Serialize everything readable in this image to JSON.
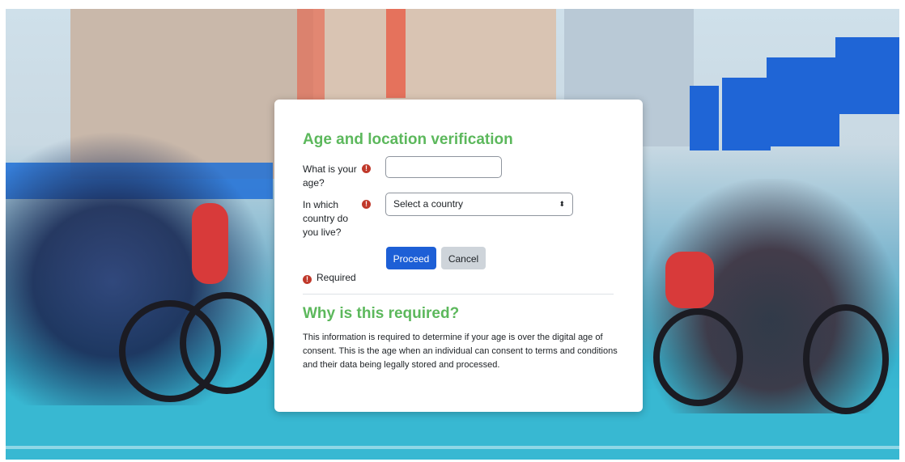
{
  "modal": {
    "title": "Age and location verification",
    "age_label": "What is your age?",
    "country_label": "In which country do you live?",
    "country_select_value": "Select a country",
    "required_icon": "exclamation-circle-icon",
    "proceed_label": "Proceed",
    "cancel_label": "Cancel",
    "required_legend": "Required",
    "why_title": "Why is this required?",
    "why_text": "This information is required to determine if your age is over the digital age of consent. This is the age when an individual can consent to terms and conditions and their data being legally stored and processed."
  },
  "colors": {
    "heading": "#5cb85c",
    "primary_button": "#1d5fd6",
    "secondary_button": "#ced4da",
    "required_icon": "#c0392b"
  }
}
